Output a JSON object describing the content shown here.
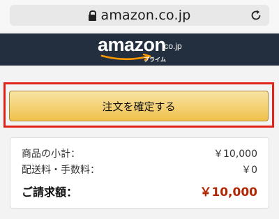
{
  "browser": {
    "url": "amazon.co.jp"
  },
  "header": {
    "logo_text": "amazon",
    "logo_tld": ".co.jp",
    "logo_sub": "プライム"
  },
  "order": {
    "place_order_label": "注文を確定する"
  },
  "summary": {
    "rows": [
      {
        "label": "商品の小計：",
        "value": "￥10,000"
      },
      {
        "label": "配送料・手数料：",
        "value": "￥0"
      }
    ],
    "total_label": "ご請求額：",
    "total_value": "￥10,000"
  },
  "colors": {
    "header_bg": "#232f3e",
    "button_bg": "#f0c14b",
    "highlight": "#e2231a",
    "total_price": "#b12704"
  }
}
